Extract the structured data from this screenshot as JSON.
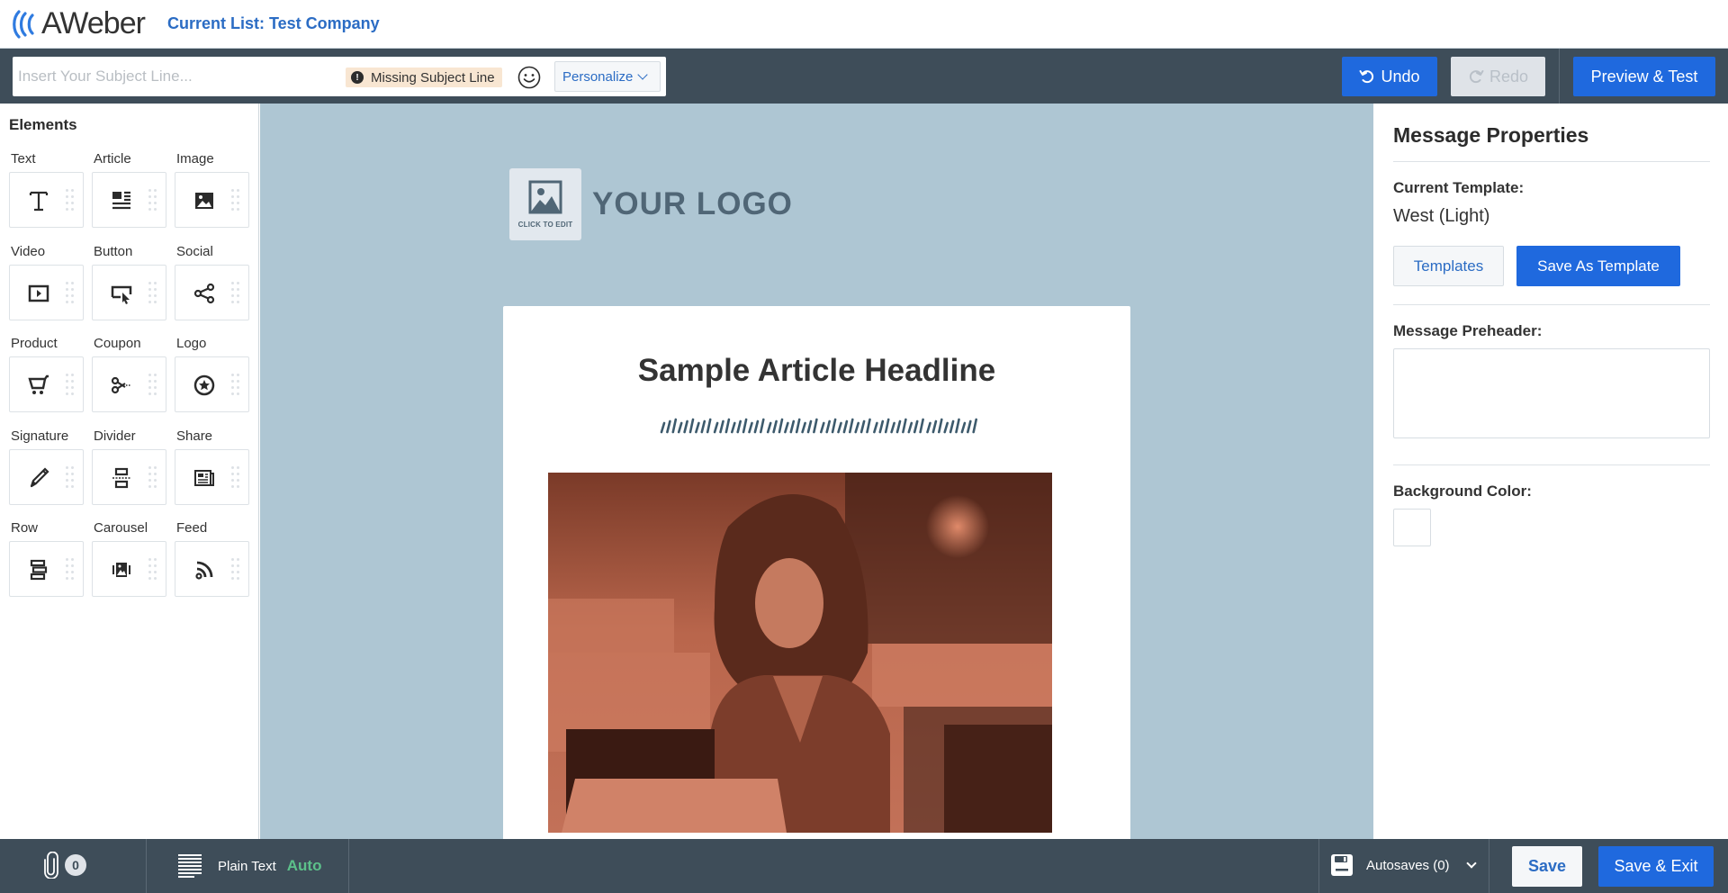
{
  "header": {
    "brand": "AWeber",
    "current_list": "Current List: Test Company"
  },
  "toolbar": {
    "subject_placeholder": "Insert Your Subject Line...",
    "subject_value": "",
    "missing_subject_badge": "Missing Subject Line",
    "emoji_icon": "smiley-face-icon",
    "personalize_label": "Personalize",
    "undo_label": "Undo",
    "redo_label": "Redo",
    "redo_disabled": true,
    "preview_label": "Preview & Test"
  },
  "sidebar": {
    "title": "Elements",
    "elements": [
      {
        "label": "Text",
        "icon": "text-icon"
      },
      {
        "label": "Article",
        "icon": "article-icon"
      },
      {
        "label": "Image",
        "icon": "image-icon"
      },
      {
        "label": "Video",
        "icon": "video-icon"
      },
      {
        "label": "Button",
        "icon": "button-cursor-icon"
      },
      {
        "label": "Social",
        "icon": "share-nodes-icon"
      },
      {
        "label": "Product",
        "icon": "cart-icon"
      },
      {
        "label": "Coupon",
        "icon": "scissors-icon"
      },
      {
        "label": "Logo",
        "icon": "star-circle-icon"
      },
      {
        "label": "Signature",
        "icon": "pen-icon"
      },
      {
        "label": "Divider",
        "icon": "divider-icon"
      },
      {
        "label": "Share",
        "icon": "newspaper-icon"
      },
      {
        "label": "Row",
        "icon": "row-icon"
      },
      {
        "label": "Carousel",
        "icon": "carousel-icon"
      },
      {
        "label": "Feed",
        "icon": "rss-icon"
      }
    ]
  },
  "canvas": {
    "logo_click_to_edit": "CLICK TO EDIT",
    "your_logo": "YOUR LOGO",
    "headline": "Sample Article Headline",
    "hero_image_alt": "Woman smiling while working on a laptop in a cafe (orange duotone)",
    "background_color": "#aec6d3"
  },
  "properties": {
    "title": "Message Properties",
    "current_template_label": "Current Template:",
    "current_template_value": "West (Light)",
    "templates_button": "Templates",
    "save_as_template_button": "Save As Template",
    "preheader_label": "Message Preheader:",
    "preheader_value": "",
    "background_color_label": "Background Color:",
    "background_color_value": "#ffffff"
  },
  "footer": {
    "attachments_count": "0",
    "plain_text_label": "Plain Text",
    "plain_text_mode": "Auto",
    "autosaves_label": "Autosaves (0)",
    "save_label": "Save",
    "save_exit_label": "Save & Exit"
  },
  "colors": {
    "primary_blue": "#1f69de",
    "link_blue": "#2b6cc4",
    "toolbar_dark": "#3e4d59",
    "success_green": "#5cc08a",
    "warning_bg": "#f8e6d2"
  }
}
